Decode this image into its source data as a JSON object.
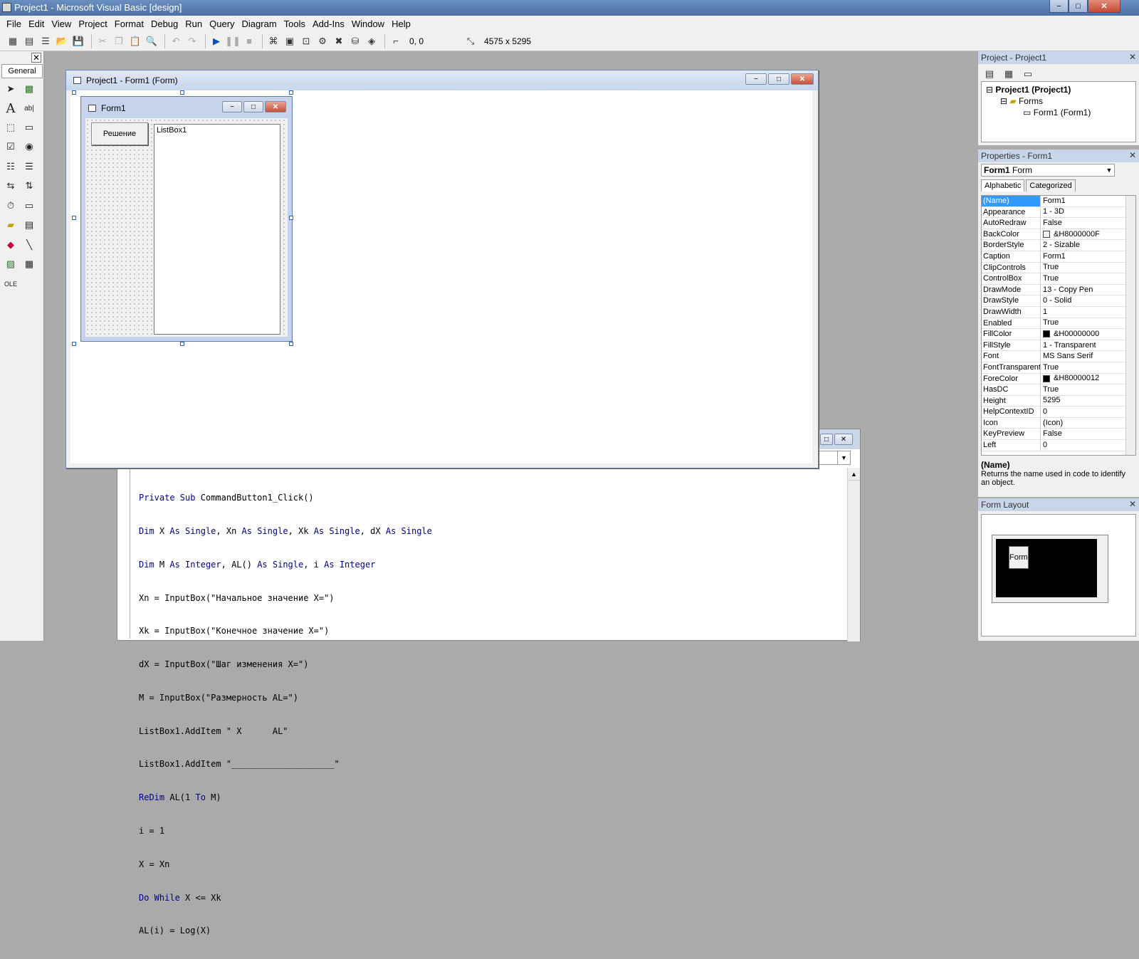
{
  "window": {
    "title": "Project1 - Microsoft Visual Basic [design]",
    "min": "−",
    "max": "□",
    "close": "✕"
  },
  "menu": [
    "File",
    "Edit",
    "View",
    "Project",
    "Format",
    "Debug",
    "Run",
    "Query",
    "Diagram",
    "Tools",
    "Add-Ins",
    "Window",
    "Help"
  ],
  "toolbar": {
    "position": "0, 0",
    "size": "4575 x 5295"
  },
  "toolbox": {
    "close": "✕",
    "tab": "General"
  },
  "designer": {
    "title": "Project1 - Form1 (Form)",
    "min": "−",
    "max": "□",
    "close": "✕"
  },
  "form1": {
    "title": "Form1",
    "min": "−",
    "max": "□",
    "close": "✕",
    "button_caption": "Решение",
    "listbox_item": "ListBox1"
  },
  "code": {
    "lines": [
      "Private Sub CommandButton1_Click()",
      "Dim X As Single, Xn As Single, Xk As Single, dX As Single",
      "Dim M As Integer, AL() As Single, i As Integer",
      "Xn = InputBox(\"Начальное значение X=\")",
      "Xk = InputBox(\"Конечное значение X=\")",
      "dX = InputBox(\"Шаг изменения X=\")",
      "M = InputBox(\"Размерность AL=\")",
      "ListBox1.AddItem \" X      AL\"",
      "ListBox1.AddItem \"____________________\"",
      "ReDim AL(1 To M)",
      "i = 1",
      "X = Xn",
      "Do While X <= Xk",
      "AL(i) = Log(X)"
    ]
  },
  "project": {
    "title": "Project - Project1",
    "close": "✕",
    "root": "Project1 (Project1)",
    "folder": "Forms",
    "item": "Form1 (Form1)"
  },
  "properties": {
    "title": "Properties - Form1",
    "close": "✕",
    "object_bold": "Form1",
    "object_type": "Form",
    "tabs": [
      "Alphabetic",
      "Categorized"
    ],
    "rows": [
      {
        "k": "(Name)",
        "v": "Form1"
      },
      {
        "k": "Appearance",
        "v": "1 - 3D"
      },
      {
        "k": "AutoRedraw",
        "v": "False"
      },
      {
        "k": "BackColor",
        "v": "&H8000000F",
        "swatch": "#f0f0f0"
      },
      {
        "k": "BorderStyle",
        "v": "2 - Sizable"
      },
      {
        "k": "Caption",
        "v": "Form1"
      },
      {
        "k": "ClipControls",
        "v": "True"
      },
      {
        "k": "ControlBox",
        "v": "True"
      },
      {
        "k": "DrawMode",
        "v": "13 - Copy Pen"
      },
      {
        "k": "DrawStyle",
        "v": "0 - Solid"
      },
      {
        "k": "DrawWidth",
        "v": "1"
      },
      {
        "k": "Enabled",
        "v": "True"
      },
      {
        "k": "FillColor",
        "v": "&H00000000",
        "swatch": "#000000"
      },
      {
        "k": "FillStyle",
        "v": "1 - Transparent"
      },
      {
        "k": "Font",
        "v": "MS Sans Serif"
      },
      {
        "k": "FontTransparent",
        "v": "True"
      },
      {
        "k": "ForeColor",
        "v": "&H80000012",
        "swatch": "#000000"
      },
      {
        "k": "HasDC",
        "v": "True"
      },
      {
        "k": "Height",
        "v": "5295"
      },
      {
        "k": "HelpContextID",
        "v": "0"
      },
      {
        "k": "Icon",
        "v": "(Icon)"
      },
      {
        "k": "KeyPreview",
        "v": "False"
      },
      {
        "k": "Left",
        "v": "0"
      }
    ],
    "desc_title": "(Name)",
    "desc_text": "Returns the name used in code to identify an object."
  },
  "layout": {
    "title": "Form Layout",
    "close": "✕",
    "mini_label": "Form"
  }
}
